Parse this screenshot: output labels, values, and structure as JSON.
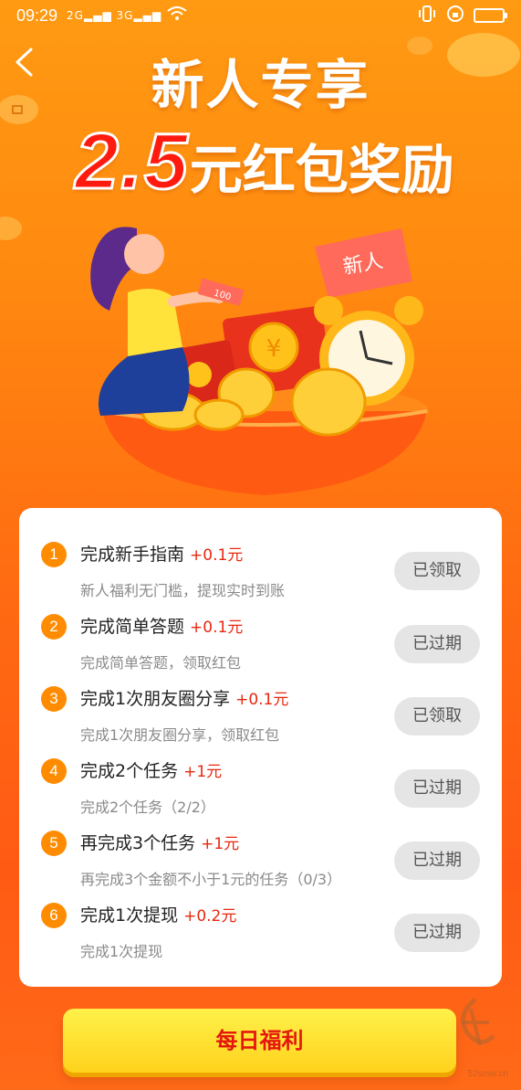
{
  "status_bar": {
    "time": "09:29",
    "signal1": "2G",
    "signal2": "3G"
  },
  "header": {
    "title": "新人专享",
    "amount": "2.5",
    "title_suffix": "元红包奖励"
  },
  "illustration": {
    "tag": "新人",
    "bill": "100"
  },
  "tasks": [
    {
      "num": "1",
      "name": "完成新手指南",
      "reward": "+0.1元",
      "desc": "新人福利无门槛，提现实时到账",
      "button": "已领取"
    },
    {
      "num": "2",
      "name": "完成简单答题",
      "reward": "+0.1元",
      "desc": "完成简单答题，领取红包",
      "button": "已过期"
    },
    {
      "num": "3",
      "name": "完成1次朋友圈分享",
      "reward": "+0.1元",
      "desc": "完成1次朋友圈分享，领取红包",
      "button": "已领取"
    },
    {
      "num": "4",
      "name": "完成2个任务",
      "reward": "+1元",
      "desc": "完成2个任务（2/2）",
      "button": "已过期"
    },
    {
      "num": "5",
      "name": "再完成3个任务",
      "reward": "+1元",
      "desc": "再完成3个金额不小于1元的任务（0/3）",
      "button": "已过期"
    },
    {
      "num": "6",
      "name": "完成1次提现",
      "reward": "+0.2元",
      "desc": "完成1次提现",
      "button": "已过期"
    }
  ],
  "daily_button": "每日福利",
  "watermark": "52smw.cn",
  "colors": {
    "accent": "#ff8c00",
    "reward": "#e8270e",
    "amount": "#ff1a10"
  }
}
